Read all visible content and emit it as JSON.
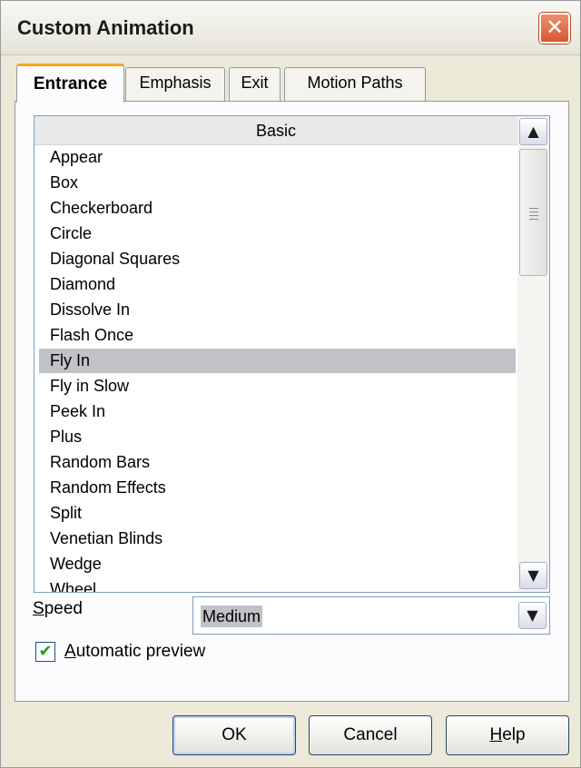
{
  "window": {
    "title": "Custom Animation",
    "close_glyph": "✕"
  },
  "tabs": [
    {
      "label": "Entrance",
      "active": true
    },
    {
      "label": "Emphasis",
      "active": false
    },
    {
      "label": "Exit",
      "active": false
    },
    {
      "label": "Motion Paths",
      "active": false
    }
  ],
  "effects_list": {
    "category": "Basic",
    "items": [
      "Appear",
      "Box",
      "Checkerboard",
      "Circle",
      "Diagonal Squares",
      "Diamond",
      "Dissolve In",
      "Flash Once",
      "Fly In",
      "Fly in Slow",
      "Peek In",
      "Plus",
      "Random Bars",
      "Random Effects",
      "Split",
      "Venetian Blinds",
      "Wedge",
      "Wheel"
    ],
    "selected": "Fly In",
    "scroll_up_glyph": "▲",
    "scroll_down_glyph": "▼"
  },
  "speed": {
    "label_accel": "S",
    "label_rest": "peed",
    "value": "Medium",
    "dropdown_glyph": "▼"
  },
  "automatic_preview": {
    "checked": true,
    "check_glyph": "✔",
    "label_accel": "A",
    "label_rest": "utomatic preview"
  },
  "buttons": {
    "ok": "OK",
    "cancel": "Cancel",
    "help_accel": "H",
    "help_rest": "elp"
  },
  "colors": {
    "dialog_bg": "#ece9d8",
    "selection": "#c1c2c6",
    "active_tab_accent": "#f5a623",
    "close_button": "#d8582e"
  }
}
